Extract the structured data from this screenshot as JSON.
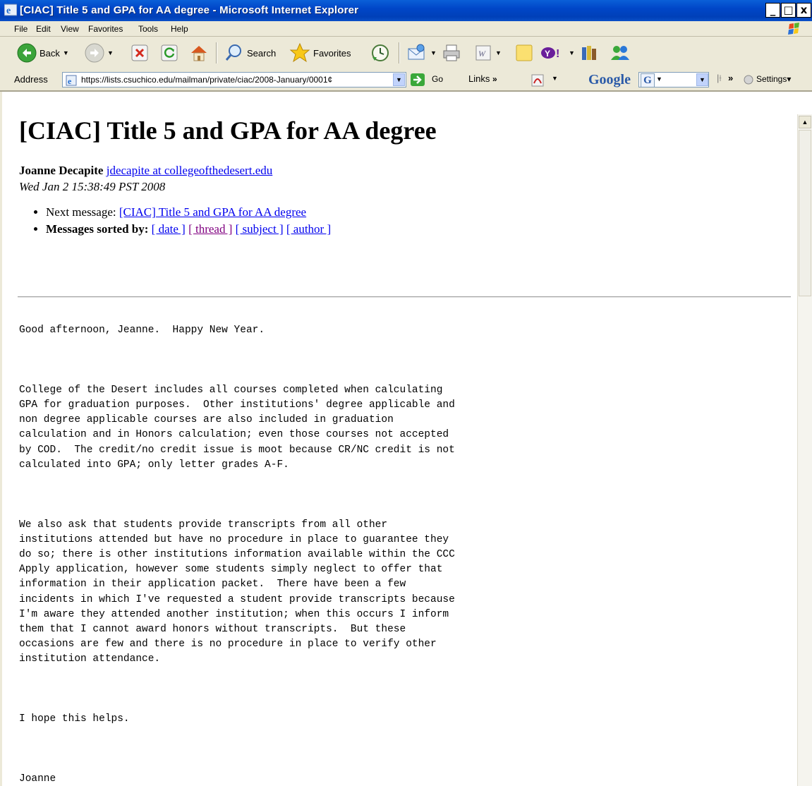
{
  "window": {
    "title": "[CIAC] Title 5 and GPA for AA degree - Microsoft Internet Explorer",
    "minimize": "_",
    "maximize": "□",
    "close": "x"
  },
  "menu": {
    "items": [
      "File",
      "Edit",
      "View",
      "Favorites",
      "Tools",
      "Help"
    ]
  },
  "toolbar": {
    "back_label": "Back",
    "search_label": "Search",
    "favorites_label": "Favorites"
  },
  "address": {
    "label": "Address",
    "url": "https://lists.csuchico.edu/mailman/private/ciac/2008-January/0001¢",
    "go_label": "Go",
    "links_label": "Links",
    "google_label": "Google",
    "settings_label": "Settings"
  },
  "page": {
    "title": "[CIAC] Title 5 and GPA for AA degree",
    "author_name": "Joanne Decapite",
    "author_email": "jdecapite at collegeofthedesert.edu",
    "date": "Wed Jan 2 15:38:49 PST 2008",
    "next_prefix": "Next message: ",
    "next_link": "[CIAC] Title 5 and GPA for AA degree",
    "sorted_prefix": "Messages sorted by:",
    "sort_links": [
      "[ date ]",
      "[ thread ]",
      "[ subject ]",
      "[ author ]"
    ],
    "body": "Good afternoon, Jeanne.  Happy New Year.\n\n \n\nCollege of the Desert includes all courses completed when calculating\nGPA for graduation purposes.  Other institutions' degree applicable and\nnon degree applicable courses are also included in graduation\ncalculation and in Honors calculation; even those courses not accepted\nby COD.  The credit/no credit issue is moot because CR/NC credit is not\ncalculated into GPA; only letter grades A-F.\n\n \n\nWe also ask that students provide transcripts from all other\ninstitutions attended but have no procedure in place to guarantee they\ndo so; there is other institutions information available within the CCC\nApply application, however some students simply neglect to offer that\ninformation in their application packet.  There have been a few\nincidents in which I've requested a student provide transcripts because\nI'm aware they attended another institution; when this occurs I inform\nthem that I cannot award honors without transcripts.  But these\noccasions are few and there is no procedure in place to verify other\ninstitution attendance.\n\n \n\nI hope this helps.\n\n \n\nJoanne"
  }
}
